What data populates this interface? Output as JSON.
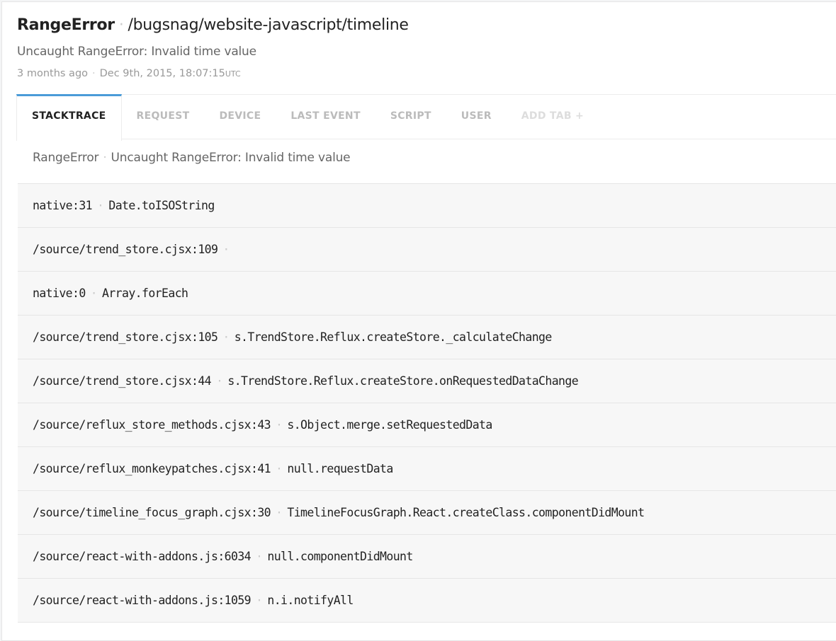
{
  "header": {
    "error_class": "RangeError",
    "context": "/bugsnag/website-javascript/timeline",
    "message": "Uncaught RangeError: Invalid time value",
    "relative_time": "3 months ago",
    "timestamp": "Dec 9th, 2015, 18:07:15",
    "timezone": "UTC"
  },
  "tabs": [
    {
      "label": "STACKTRACE",
      "active": true
    },
    {
      "label": "REQUEST"
    },
    {
      "label": "DEVICE"
    },
    {
      "label": "LAST EVENT"
    },
    {
      "label": "SCRIPT"
    },
    {
      "label": "USER"
    },
    {
      "label": "ADD TAB +"
    }
  ],
  "stacktrace": {
    "error_class": "RangeError",
    "message": "Uncaught RangeError: Invalid time value",
    "frames": [
      {
        "file": "native:31",
        "method": "Date.toISOString"
      },
      {
        "file": "/source/trend_store.cjsx:109",
        "method": ""
      },
      {
        "file": "native:0",
        "method": "Array.forEach"
      },
      {
        "file": "/source/trend_store.cjsx:105",
        "method": "s.TrendStore.Reflux.createStore._calculateChange"
      },
      {
        "file": "/source/trend_store.cjsx:44",
        "method": "s.TrendStore.Reflux.createStore.onRequestedDataChange"
      },
      {
        "file": "/source/reflux_store_methods.cjsx:43",
        "method": "s.Object.merge.setRequestedData"
      },
      {
        "file": "/source/reflux_monkeypatches.cjsx:41",
        "method": "null.requestData"
      },
      {
        "file": "/source/timeline_focus_graph.cjsx:30",
        "method": "TimelineFocusGraph.React.createClass.componentDidMount"
      },
      {
        "file": "/source/react-with-addons.js:6034",
        "method": "null.componentDidMount"
      },
      {
        "file": "/source/react-with-addons.js:1059",
        "method": "n.i.notifyAll"
      }
    ]
  },
  "colors": {
    "accent": "#4a9bd8"
  }
}
